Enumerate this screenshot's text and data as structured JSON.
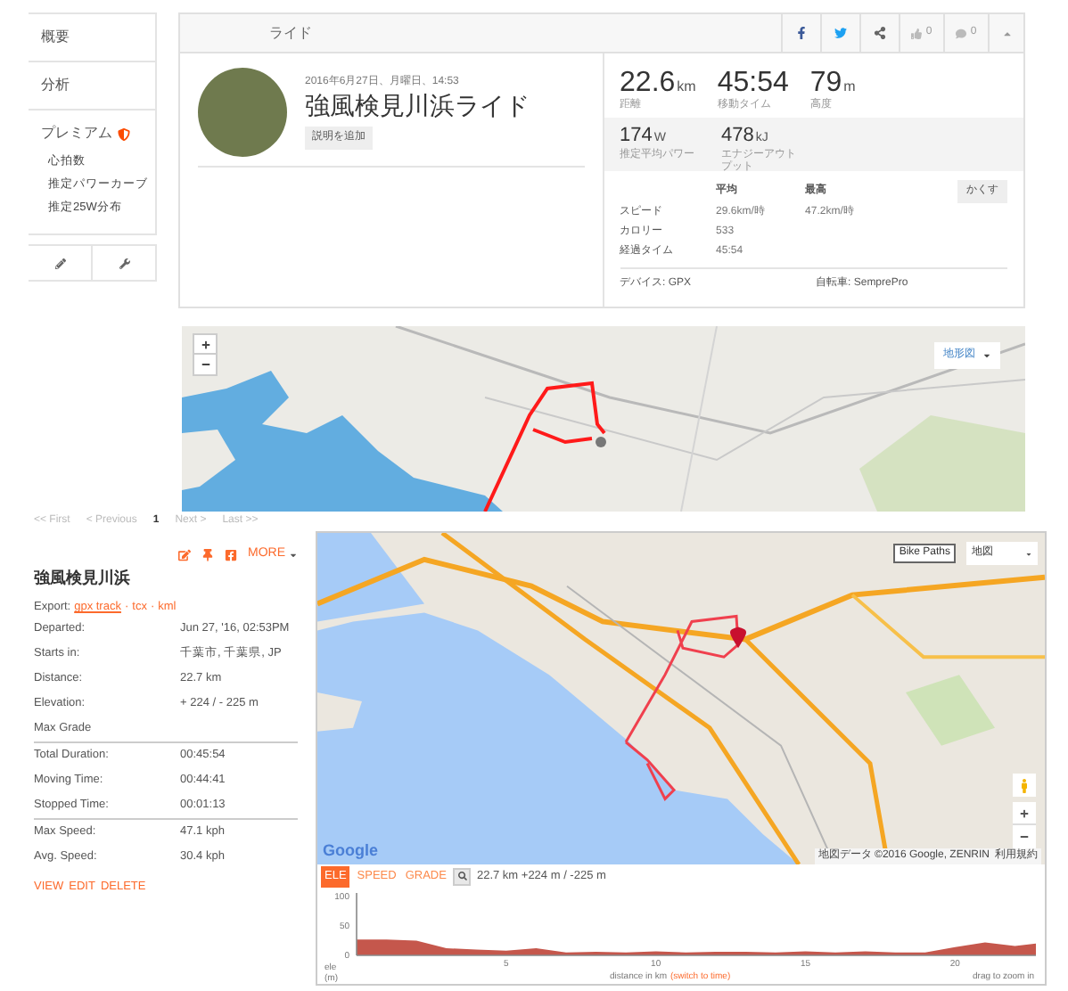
{
  "sidebar": {
    "items": [
      {
        "label": "概要",
        "premium": false
      },
      {
        "label": "分析",
        "premium": false
      },
      {
        "label": "プレミアム",
        "premium": true,
        "children": [
          {
            "label": "心拍数"
          },
          {
            "label": "推定パワーカーブ"
          },
          {
            "label": "推定25W分布"
          }
        ]
      }
    ]
  },
  "header": {
    "title": "ライド",
    "likes": "0",
    "comments": "0"
  },
  "activity": {
    "date": "2016年6月27日、月曜日、14:53",
    "name": "強風検見川浜ライド",
    "add_description": "説明を追加"
  },
  "stats": [
    {
      "value": "22.6",
      "unit": "km",
      "label": "距離"
    },
    {
      "value": "45:54",
      "label": "移動タイム"
    },
    {
      "value": "79",
      "unit": "m",
      "label": "高度"
    }
  ],
  "power_stats": [
    {
      "value": "174",
      "unit": "W",
      "label": "推定平均パワー"
    },
    {
      "value": "478",
      "unit": "kJ",
      "label": "エナジーアウトプット"
    }
  ],
  "details": {
    "columns": [
      "平均",
      "最高"
    ],
    "hide_button": "かくす",
    "rows": [
      {
        "label": "スピード",
        "avg": "29.6km/時",
        "max": "47.2km/時"
      },
      {
        "label": "カロリー",
        "avg": "533"
      },
      {
        "label": "経過タイム",
        "avg": "45:54"
      }
    ],
    "device": "デバイス: GPX",
    "bike": "自転車: SemprePro"
  },
  "map_top": {
    "layer_button": "地形図"
  },
  "pagination": [
    {
      "label": "<< First",
      "selected": false
    },
    {
      "label": "< Previous",
      "selected": false
    },
    {
      "label": "1",
      "selected": true
    },
    {
      "label": "Next >",
      "selected": false
    },
    {
      "label": "Last >>",
      "selected": false
    }
  ],
  "ride": {
    "more": "MORE",
    "title": "強風検見川浜",
    "export_label": "Export:",
    "exports": [
      "gpx track",
      "tcx",
      "kml"
    ],
    "export_separator": "·",
    "groups": [
      [
        {
          "label": "Departed:",
          "value": "Jun 27, '16, 02:53PM"
        },
        {
          "label": "Starts in:",
          "value": "千葉市, 千葉県, JP"
        },
        {
          "label": "Distance:",
          "value": "22.7 km"
        },
        {
          "label": "Elevation:",
          "value": "+ 224 / - 225 m"
        },
        {
          "label": "Max Grade"
        }
      ],
      [
        {
          "label": "Total Duration:",
          "value": "00:45:54"
        },
        {
          "label": "Moving Time:",
          "value": "00:44:41"
        },
        {
          "label": "Stopped Time:",
          "value": "00:01:13"
        }
      ],
      [
        {
          "label": "Max Speed:",
          "value": "47.1 kph"
        },
        {
          "label": "Avg. Speed:",
          "value": "30.4 kph"
        }
      ]
    ],
    "actions": [
      "VIEW",
      "EDIT",
      "DELETE"
    ]
  },
  "map_main": {
    "bike_paths": "Bike Paths",
    "map_type": "地図",
    "logo": "Google",
    "attribution": "地図データ ©2016 Google, ZENRIN",
    "terms": "利用規約"
  },
  "elevation": {
    "tabs": [
      {
        "label": "ELE",
        "selected": true
      },
      {
        "label": "SPEED",
        "selected": false
      },
      {
        "label": "GRADE",
        "selected": false
      }
    ],
    "summary": "22.7 km +224 m / -225 m",
    "switch_link": "(switch to time)",
    "hint": "drag to zoom in",
    "chart_data": {
      "type": "area",
      "xlabel": "distance in km",
      "ylabel": "ele (m)",
      "x": [
        0,
        1,
        2,
        3,
        4,
        5,
        6,
        7,
        8,
        9,
        10,
        11,
        12,
        13,
        14,
        15,
        16,
        17,
        18,
        19,
        20,
        21,
        22,
        22.7
      ],
      "series": [
        {
          "color": "#c5574c",
          "values": [
            27,
            27,
            25,
            12,
            10,
            8,
            12,
            5,
            6,
            5,
            7,
            5,
            6,
            6,
            5,
            7,
            5,
            7,
            5,
            5,
            14,
            22,
            16,
            20
          ]
        }
      ],
      "xlim": [
        0,
        22.7
      ],
      "ylim": [
        0,
        100
      ],
      "xticks": [
        5,
        10,
        15,
        20
      ],
      "yticks": [
        0,
        50,
        100
      ]
    }
  }
}
